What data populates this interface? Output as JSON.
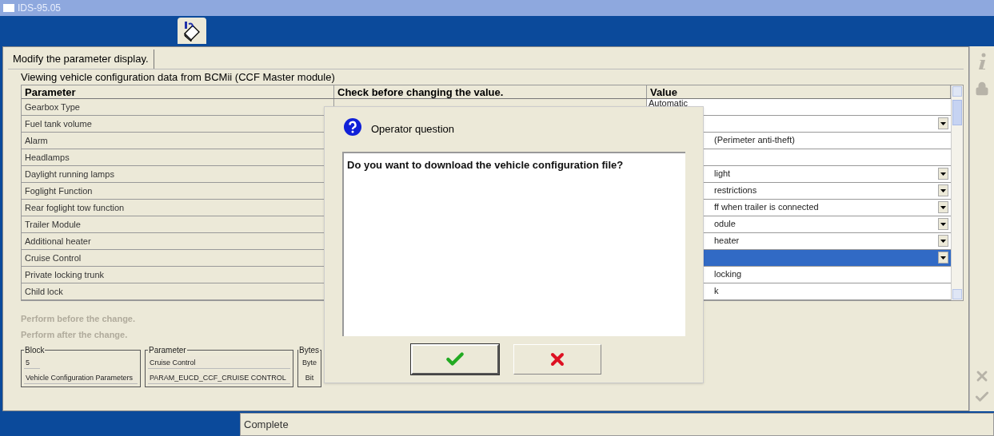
{
  "window": {
    "title": "IDS-95.05"
  },
  "tab": {
    "label": "Modify the parameter display.",
    "selected": true
  },
  "subtitle": "Viewing vehicle configuration data from BCMii (CCF Master module)",
  "table": {
    "columns": [
      "Parameter",
      "Check before changing the value.",
      "Value"
    ],
    "rows": [
      {
        "parameter": "Gearbox Type",
        "value": "Automatic",
        "kind": "text",
        "selected": false
      },
      {
        "parameter": "Fuel tank volume",
        "kind": "dropdown",
        "selected": false
      },
      {
        "parameter": "Alarm",
        "value": "(Perimeter anti-theft)",
        "kind": "text",
        "selected": false
      },
      {
        "parameter": "Headlamps",
        "kind": "text",
        "selected": false
      },
      {
        "parameter": "Daylight running lamps",
        "value": "light",
        "kind": "dropdown",
        "selected": false
      },
      {
        "parameter": "Foglight Function",
        "value": "restrictions",
        "kind": "dropdown",
        "selected": false
      },
      {
        "parameter": "Rear foglight tow function",
        "value": "ff when trailer is connected",
        "kind": "dropdown",
        "selected": false
      },
      {
        "parameter": "Trailer Module",
        "value": "odule",
        "kind": "dropdown",
        "selected": false
      },
      {
        "parameter": "Additional heater",
        "value": "heater",
        "kind": "dropdown",
        "selected": false
      },
      {
        "parameter": "Cruise Control",
        "kind": "dropdown",
        "selected": true
      },
      {
        "parameter": "Private locking trunk",
        "value": "locking",
        "kind": "text",
        "selected": false
      },
      {
        "parameter": "Child lock",
        "value": "k",
        "kind": "text",
        "selected": false
      }
    ]
  },
  "notes": [
    {
      "text": "Perform before the change.",
      "disabled": true
    },
    {
      "text": "Perform after the change.",
      "disabled": true
    }
  ],
  "groups": [
    {
      "title": "Block",
      "fields": [
        "5",
        "Vehicle Configuration Parameters"
      ]
    },
    {
      "title": "Parameter",
      "fields": [
        "Cruise Control",
        "PARAM_EUCD_CCF_CRUISE CONTROL"
      ]
    },
    {
      "title": "Bytes",
      "labels": [
        "Byte",
        "Bit"
      ]
    }
  ],
  "dialog": {
    "title": "Operator question",
    "message": "Do you want to download the vehicle configuration file?",
    "buttons": [
      {
        "kind": "ok"
      },
      {
        "kind": "cancel"
      }
    ]
  },
  "status_bar": {
    "text": "Complete"
  }
}
